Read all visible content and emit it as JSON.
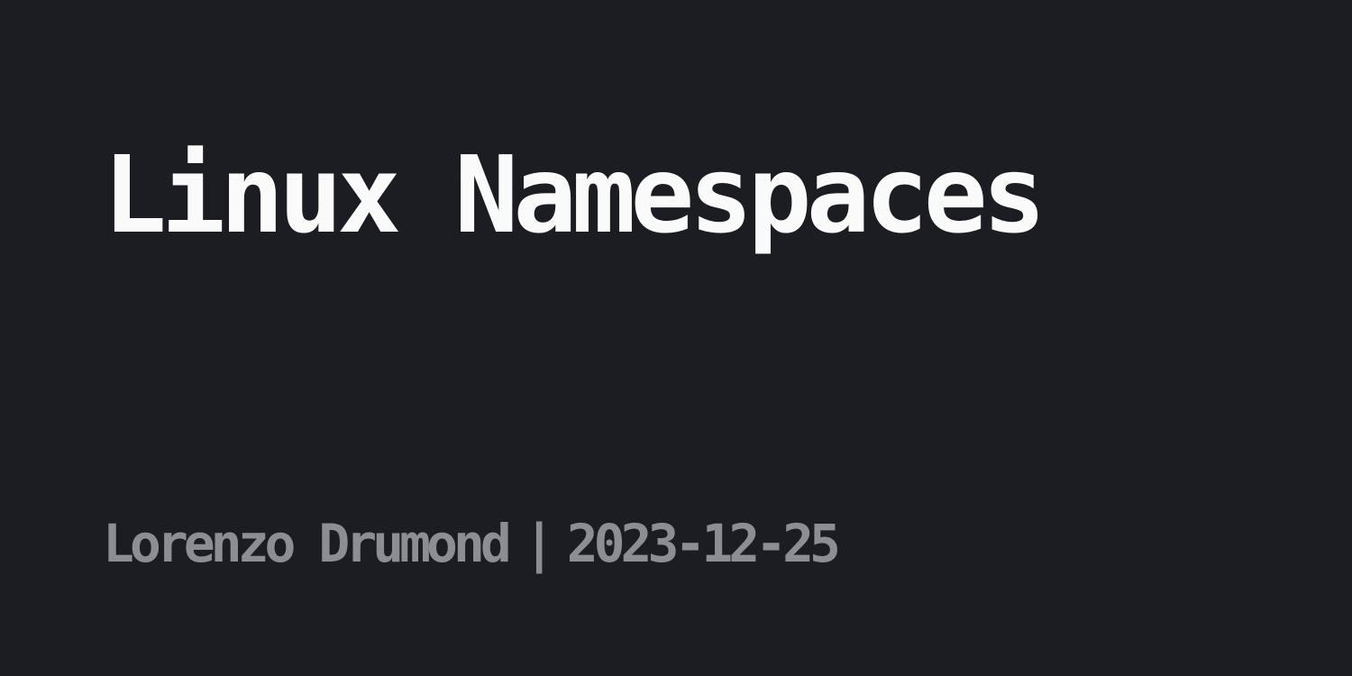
{
  "post": {
    "title": "Linux Namespaces",
    "author": "Lorenzo Drumond",
    "separator": "|",
    "date": "2023-12-25"
  },
  "colors": {
    "background": "#1c1d22",
    "title": "#fafafa",
    "byline": "#8d8e93"
  }
}
